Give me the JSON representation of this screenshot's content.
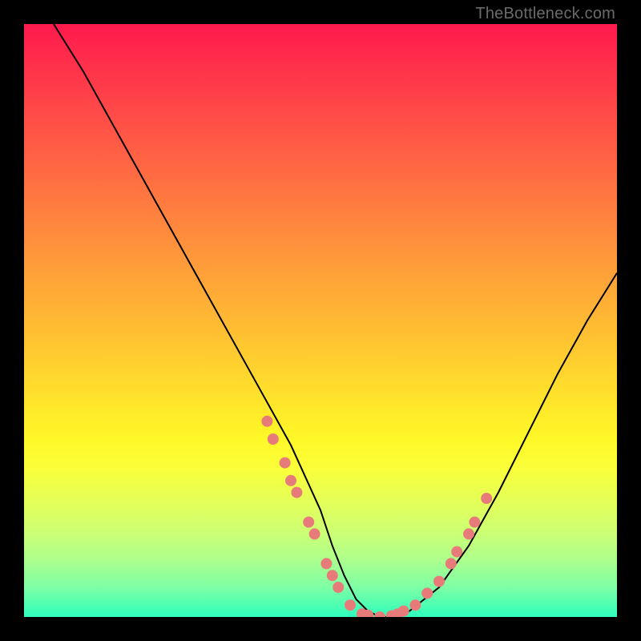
{
  "watermark": "TheBottleneck.com",
  "chart_data": {
    "type": "line",
    "title": "",
    "xlabel": "",
    "ylabel": "",
    "xlim": [
      0,
      100
    ],
    "ylim": [
      0,
      100
    ],
    "series": [
      {
        "name": "bottleneck-curve",
        "color": "#000000",
        "x": [
          5,
          10,
          15,
          20,
          25,
          30,
          35,
          40,
          45,
          50,
          52,
          54,
          56,
          58,
          60,
          62,
          65,
          70,
          75,
          80,
          85,
          90,
          95,
          100
        ],
        "y": [
          100,
          92,
          83,
          74,
          65,
          56,
          47,
          38,
          29,
          18,
          12,
          7,
          3,
          1,
          0,
          0,
          1,
          5,
          12,
          21,
          31,
          41,
          50,
          58
        ]
      }
    ],
    "highlight_points": {
      "name": "dotted-segments",
      "color": "#e77b7a",
      "points": [
        {
          "x": 41,
          "y": 33
        },
        {
          "x": 42,
          "y": 30
        },
        {
          "x": 44,
          "y": 26
        },
        {
          "x": 45,
          "y": 23
        },
        {
          "x": 46,
          "y": 21
        },
        {
          "x": 48,
          "y": 16
        },
        {
          "x": 49,
          "y": 14
        },
        {
          "x": 51,
          "y": 9
        },
        {
          "x": 52,
          "y": 7
        },
        {
          "x": 53,
          "y": 5
        },
        {
          "x": 55,
          "y": 2
        },
        {
          "x": 57,
          "y": 0.5
        },
        {
          "x": 58,
          "y": 0.3
        },
        {
          "x": 60,
          "y": 0
        },
        {
          "x": 62,
          "y": 0.2
        },
        {
          "x": 63,
          "y": 0.5
        },
        {
          "x": 64,
          "y": 1
        },
        {
          "x": 66,
          "y": 2
        },
        {
          "x": 68,
          "y": 4
        },
        {
          "x": 70,
          "y": 6
        },
        {
          "x": 72,
          "y": 9
        },
        {
          "x": 73,
          "y": 11
        },
        {
          "x": 75,
          "y": 14
        },
        {
          "x": 76,
          "y": 16
        },
        {
          "x": 78,
          "y": 20
        }
      ]
    },
    "gradient_bands": [
      {
        "pos": 0,
        "color": "#ff1a4d"
      },
      {
        "pos": 50,
        "color": "#ffb933"
      },
      {
        "pos": 75,
        "color": "#faff3a"
      },
      {
        "pos": 100,
        "color": "#2effbc"
      }
    ]
  }
}
